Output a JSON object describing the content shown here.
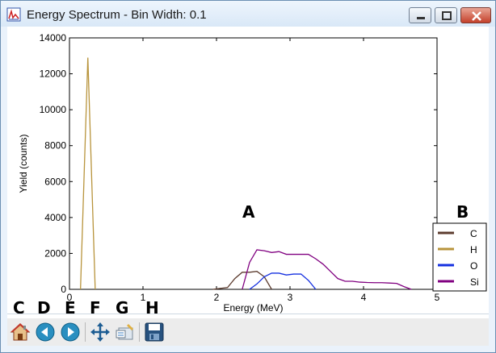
{
  "window": {
    "title": "Energy Spectrum - Bin Width: 0.1",
    "controls": {
      "minimize": "minimize-icon",
      "maximize": "maximize-icon",
      "close": "close-icon"
    }
  },
  "annotations": {
    "A": "A",
    "B": "B",
    "C": "C",
    "D": "D",
    "E": "E",
    "F": "F",
    "G": "G",
    "H": "H"
  },
  "toolbar": {
    "buttons": [
      {
        "icon": "home-icon"
      },
      {
        "icon": "back-arrow-icon"
      },
      {
        "icon": "forward-arrow-icon"
      },
      {
        "icon": "pan-move-icon"
      },
      {
        "icon": "zoom-rectangle-icon"
      },
      {
        "icon": "save-icon"
      }
    ]
  },
  "chart_data": {
    "type": "line",
    "title": "",
    "xlabel": "Energy (MeV)",
    "ylabel": "Yield (counts)",
    "xlim": [
      0,
      5
    ],
    "ylim": [
      0,
      14000
    ],
    "xticks": [
      "0",
      "1",
      "2",
      "3",
      "4",
      "5"
    ],
    "yticks": [
      "0",
      "2000",
      "4000",
      "6000",
      "8000",
      "10000",
      "12000",
      "14000"
    ],
    "grid": false,
    "legend_position": "right",
    "series": [
      {
        "name": "C",
        "color": "#5c3b2e",
        "x": [
          1.95,
          2.05,
          2.15,
          2.25,
          2.35,
          2.45,
          2.55,
          2.65,
          2.75
        ],
        "y": [
          0,
          50,
          100,
          600,
          950,
          950,
          1000,
          700,
          0
        ]
      },
      {
        "name": "H",
        "color": "#b8943c",
        "x": [
          0.15,
          0.25,
          0.35
        ],
        "y": [
          0,
          12900,
          0
        ]
      },
      {
        "name": "O",
        "color": "#1530e0",
        "x": [
          2.45,
          2.55,
          2.65,
          2.75,
          2.85,
          2.95,
          3.05,
          3.15,
          3.25,
          3.35
        ],
        "y": [
          0,
          300,
          700,
          900,
          900,
          800,
          850,
          850,
          500,
          0
        ]
      },
      {
        "name": "Si",
        "color": "#800080",
        "x": [
          2.35,
          2.45,
          2.55,
          2.65,
          2.75,
          2.85,
          2.95,
          3.05,
          3.15,
          3.25,
          3.35,
          3.45,
          3.55,
          3.65,
          3.75,
          3.85,
          3.95,
          4.05,
          4.15,
          4.25,
          4.35,
          4.45,
          4.55,
          4.65
        ],
        "y": [
          0,
          1500,
          2200,
          2150,
          2050,
          2100,
          1950,
          1950,
          1950,
          1950,
          1700,
          1400,
          1000,
          600,
          450,
          450,
          400,
          380,
          370,
          370,
          350,
          330,
          150,
          0
        ]
      }
    ]
  }
}
